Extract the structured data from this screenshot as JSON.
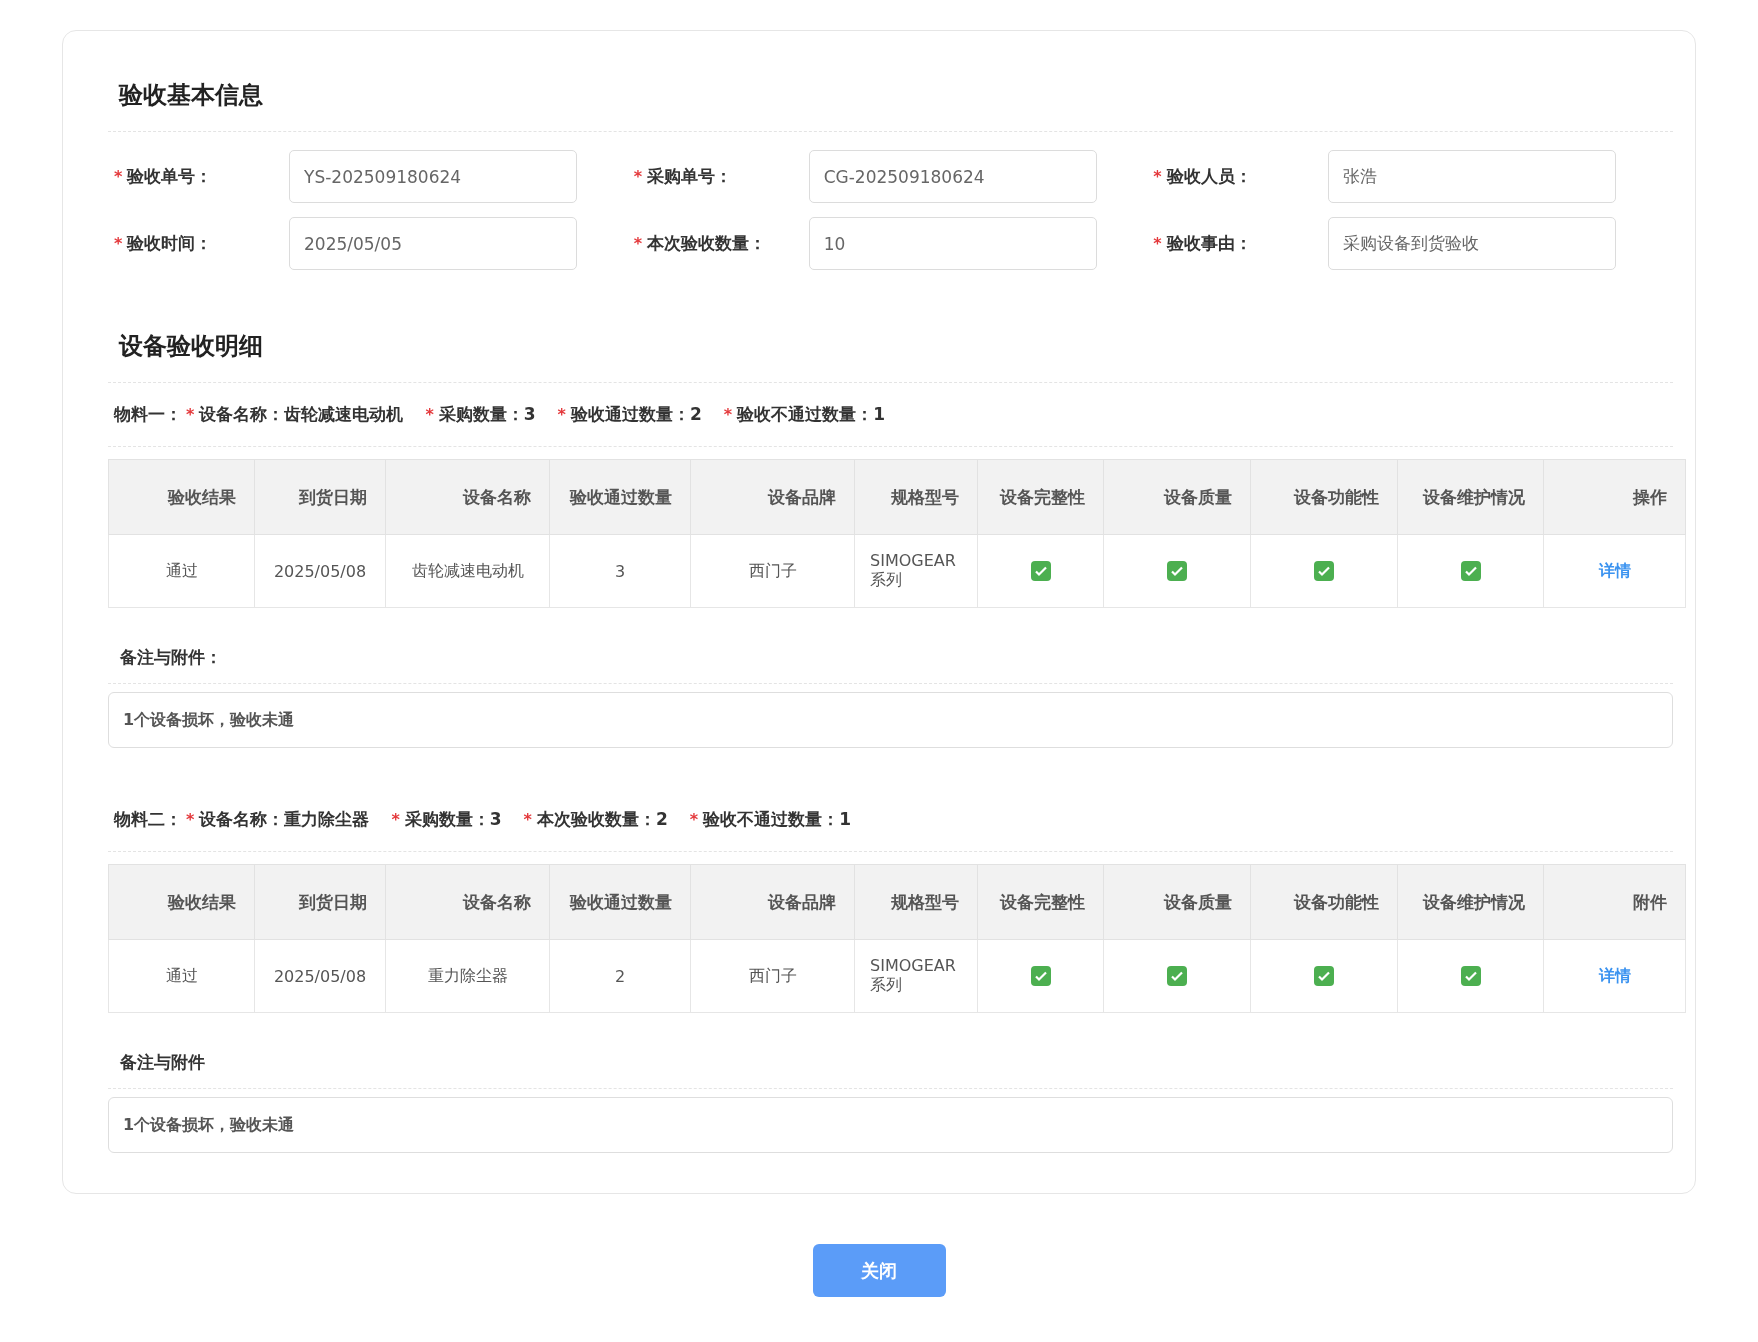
{
  "basic_info": {
    "title": "验收基本信息",
    "fields": [
      {
        "required_mark": "*",
        "label": "验收单号：",
        "value": "YS-202509180624"
      },
      {
        "required_mark": "*",
        "label": "采购单号：",
        "value": "CG-202509180624"
      },
      {
        "required_mark": "*",
        "label": "验收人员：",
        "value": "张浩"
      },
      {
        "required_mark": "*",
        "label": "验收时间：",
        "value": "2025/05/05"
      },
      {
        "required_mark": "*",
        "label": "本次验收数量：",
        "value": "10"
      },
      {
        "required_mark": "*",
        "label": "验收事由：",
        "value": "采购设备到货验收"
      }
    ]
  },
  "details": {
    "title": "设备验收明细",
    "materials": [
      {
        "heading": "物料一：",
        "summary": [
          {
            "required_mark": "*",
            "text": "设备名称：齿轮减速电动机"
          },
          {
            "required_mark": "*",
            "text": "采购数量：3"
          },
          {
            "required_mark": "*",
            "text": "验收通过数量：2"
          },
          {
            "required_mark": "*",
            "text": "验收不通过数量：1"
          }
        ],
        "columns": [
          "验收结果",
          "到货日期",
          "设备名称",
          "验收通过数量",
          "设备品牌",
          "规格型号",
          "设备完整性",
          "设备质量",
          "设备功能性",
          "设备维护情况",
          "操作"
        ],
        "rows": [
          {
            "result": "通过",
            "date": "2025/05/08",
            "name": "齿轮减速电动机",
            "qty": "3",
            "brand": "西门子",
            "model": "SIMOGEAR 系列",
            "checks": [
              {
                "checked": true
              },
              {
                "checked": true
              },
              {
                "checked": true
              },
              {
                "checked": true
              }
            ],
            "action": "详情"
          }
        ],
        "notes_label": "备注与附件：",
        "notes": "1个设备损坏，验收未通"
      },
      {
        "heading": "物料二：",
        "summary": [
          {
            "required_mark": "*",
            "text": "设备名称：重力除尘器"
          },
          {
            "required_mark": "*",
            "text": "采购数量：3"
          },
          {
            "required_mark": "*",
            "text": "本次验收数量：2"
          },
          {
            "required_mark": "*",
            "text": "验收不通过数量：1"
          }
        ],
        "columns": [
          "验收结果",
          "到货日期",
          "设备名称",
          "验收通过数量",
          "设备品牌",
          "规格型号",
          "设备完整性",
          "设备质量",
          "设备功能性",
          "设备维护情况",
          "附件"
        ],
        "rows": [
          {
            "result": "通过",
            "date": "2025/05/08",
            "name": "重力除尘器",
            "qty": "2",
            "brand": "西门子",
            "model": "SIMOGEAR 系列",
            "checks": [
              {
                "checked": true
              },
              {
                "checked": true
              },
              {
                "checked": true
              },
              {
                "checked": true
              }
            ],
            "action": "详情"
          }
        ],
        "notes_label": "备注与附件",
        "notes": "1个设备损坏，验收未通"
      }
    ]
  },
  "close_button": "关闭"
}
